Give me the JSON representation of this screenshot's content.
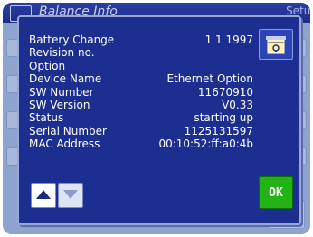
{
  "window": {
    "title": "Balance Info",
    "setup_label": "Setup"
  },
  "info": {
    "rows": [
      {
        "label": "Battery Change",
        "value": "1 1 1997"
      },
      {
        "label": "Revision no.",
        "value": ""
      },
      {
        "label": "Option",
        "value": ""
      },
      {
        "label": "Device Name",
        "value": "Ethernet Option"
      },
      {
        "label": "SW Number",
        "value": "11670910"
      },
      {
        "label": "SW Version",
        "value": "V0.33"
      },
      {
        "label": "Status",
        "value": "starting up"
      },
      {
        "label": "Serial Number",
        "value": "1125131597"
      },
      {
        "label": "MAC Address",
        "value": "00:10:52:ff:a0:4b"
      }
    ]
  },
  "buttons": {
    "ok_label": "OK",
    "info_icon": "info-help-icon",
    "scroll_up_icon": "arrow-up-icon",
    "scroll_down_icon": "arrow-down-icon"
  },
  "colors": {
    "dialog_background": "#1c2e90",
    "ok_button": "#22b414",
    "background_window": "#8fa3cf"
  }
}
